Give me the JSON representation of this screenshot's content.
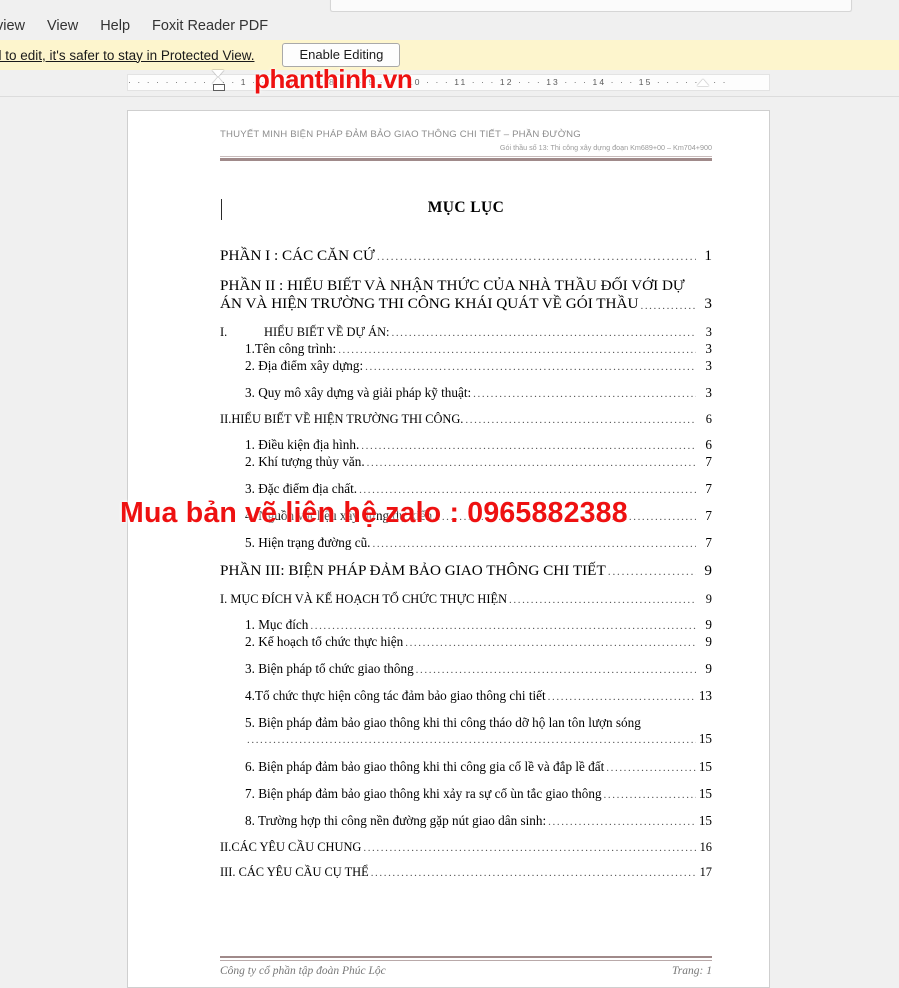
{
  "app": {
    "menu": {
      "items": [
        {
          "label": "view",
          "clipped": true
        },
        {
          "label": "View",
          "clipped": false
        },
        {
          "label": "Help",
          "clipped": false
        },
        {
          "label": "Foxit Reader PDF",
          "clipped": false
        }
      ]
    },
    "protected_view": {
      "message": "d to edit, it's safer to stay in Protected View.",
      "button_label": "Enable Editing",
      "background": "#fdf5cd"
    },
    "ruler": {
      "ticks": "·  ·  ·  ·  ·  ·  ·  ·  ·  ·  ·  ·  1  ·  ·  ·  ·  7  ·  ·  ·  8  ·  ·  ·  9  ·  ·  ·  10 ·  ·  · 11 ·  ·  · 12 ·  ·  · 13 ·  ·  · 14 ·  ·  · 15 ·  ·  ·  ·  ·  ·  ·  ·",
      "left_indent_marker": "hourglass-indent-marker",
      "right_indent_marker": "right-indent-marker"
    }
  },
  "watermarks": {
    "top": "phanthinh.vn",
    "middle": "Mua bản vẽ liên hệ zalo : 0965882388",
    "color": "#ee1111"
  },
  "document": {
    "header": {
      "line1": "THUYẾT MINH BIỆN PHÁP ĐẢM BẢO GIAO THÔNG CHI TIẾT – PHẦN ĐƯỜNG",
      "line2": "Gói thầu số  13: Thi công xây dựng đoạn Km689+00 – Km704+900"
    },
    "title": "MỤC LỤC",
    "footer": {
      "left": "Công ty cổ phần tập đoàn Phúc Lộc",
      "right": "Trang: 1"
    },
    "toc": [
      {
        "kind": "single",
        "level": "part",
        "label": "PHẦN I : CÁC CĂN CỨ",
        "page": "1"
      },
      {
        "kind": "wrapped",
        "level": "part",
        "line1": "PHẦN II : HIỂU BIẾT VÀ NHẬN THỨC CỦA NHÀ THẦU ĐỐI VỚI DỰ",
        "line2": "ÁN VÀ HIỆN TRƯỜNG THI CÔNG KHÁI QUÁT VỀ GÓI THẦU",
        "page": "3"
      },
      {
        "kind": "roman",
        "level": "roman",
        "number": "I.",
        "label": "HIỂU BIẾT VỀ DỰ ÁN:",
        "page": "3"
      },
      {
        "kind": "single",
        "level": "sub-tight",
        "label": "1.Tên công trình:",
        "page": "3"
      },
      {
        "kind": "single",
        "level": "sub",
        "label": "2. Địa điểm xây dựng: ",
        "page": "3"
      },
      {
        "kind": "single",
        "level": "sub",
        "label": "3. Quy mô xây dựng và giải pháp kỹ thuật:",
        "page": "3"
      },
      {
        "kind": "single",
        "level": "heading",
        "label": "II.HIỂU BIẾT VỀ HIỆN TRƯỜNG THI CÔNG.",
        "page": "6"
      },
      {
        "kind": "single",
        "level": "sub-tight",
        "label": "1. Điều kiện địa hình.",
        "page": "6"
      },
      {
        "kind": "single",
        "level": "sub",
        "label": "2. Khí tượng thủy văn.",
        "page": "7"
      },
      {
        "kind": "single",
        "level": "sub",
        "label": "3. Đặc điểm địa chất.",
        "page": "7"
      },
      {
        "kind": "single",
        "level": "sub",
        "label": "4. Nguồn vật liệu xây dựng dự kiến.",
        "page": "7"
      },
      {
        "kind": "single",
        "level": "sub",
        "label": "5. Hiện trạng đường cũ. ",
        "page": "7"
      },
      {
        "kind": "single",
        "level": "part",
        "label": "PHẦN III: BIỆN PHÁP ĐẢM BẢO GIAO THÔNG CHI TIẾT ",
        "page": "9"
      },
      {
        "kind": "single",
        "level": "heading",
        "label": "I. MỤC ĐÍCH VÀ KẾ HOẠCH TỔ CHỨC THỰC HIỆN",
        "page": "9"
      },
      {
        "kind": "single",
        "level": "sub-tight",
        "label": "1. Mục đích",
        "page": "9"
      },
      {
        "kind": "single",
        "level": "sub",
        "label": "2. Kế hoạch tổ chức thực hiện ",
        "page": "9"
      },
      {
        "kind": "single",
        "level": "sub",
        "label": "3. Biện pháp tổ chức giao thông ",
        "page": "9"
      },
      {
        "kind": "single",
        "level": "sub",
        "label": "4.Tổ chức thực hiện công tác đảm bảo giao thông chi tiết",
        "page": "13"
      },
      {
        "kind": "wrapped-sub",
        "level": "sub",
        "line1": "5. Biện pháp đảm bảo giao thông khi thi công tháo dỡ hộ lan tôn lượn sóng",
        "page": "15"
      },
      {
        "kind": "single",
        "level": "sub",
        "label": "6. Biện pháp đảm bảo giao thông khi thi công gia cố lề và đắp lề đất ",
        "page": "15"
      },
      {
        "kind": "single",
        "level": "sub",
        "label": "7. Biện pháp đảm bảo giao thông khi xảy ra sự cố ùn tắc giao thông ",
        "page": "15"
      },
      {
        "kind": "single",
        "level": "sub",
        "label": "8. Trường hợp thi công nền đường gặp nút giao dân sinh:",
        "page": "15"
      },
      {
        "kind": "single",
        "level": "heading-tight",
        "label": "II.CÁC YÊU CẦU CHUNG ",
        "page": "16"
      },
      {
        "kind": "single",
        "level": "heading-tight",
        "label": "III. CÁC YÊU CẦU CỤ THỂ ",
        "page": "17"
      }
    ]
  }
}
